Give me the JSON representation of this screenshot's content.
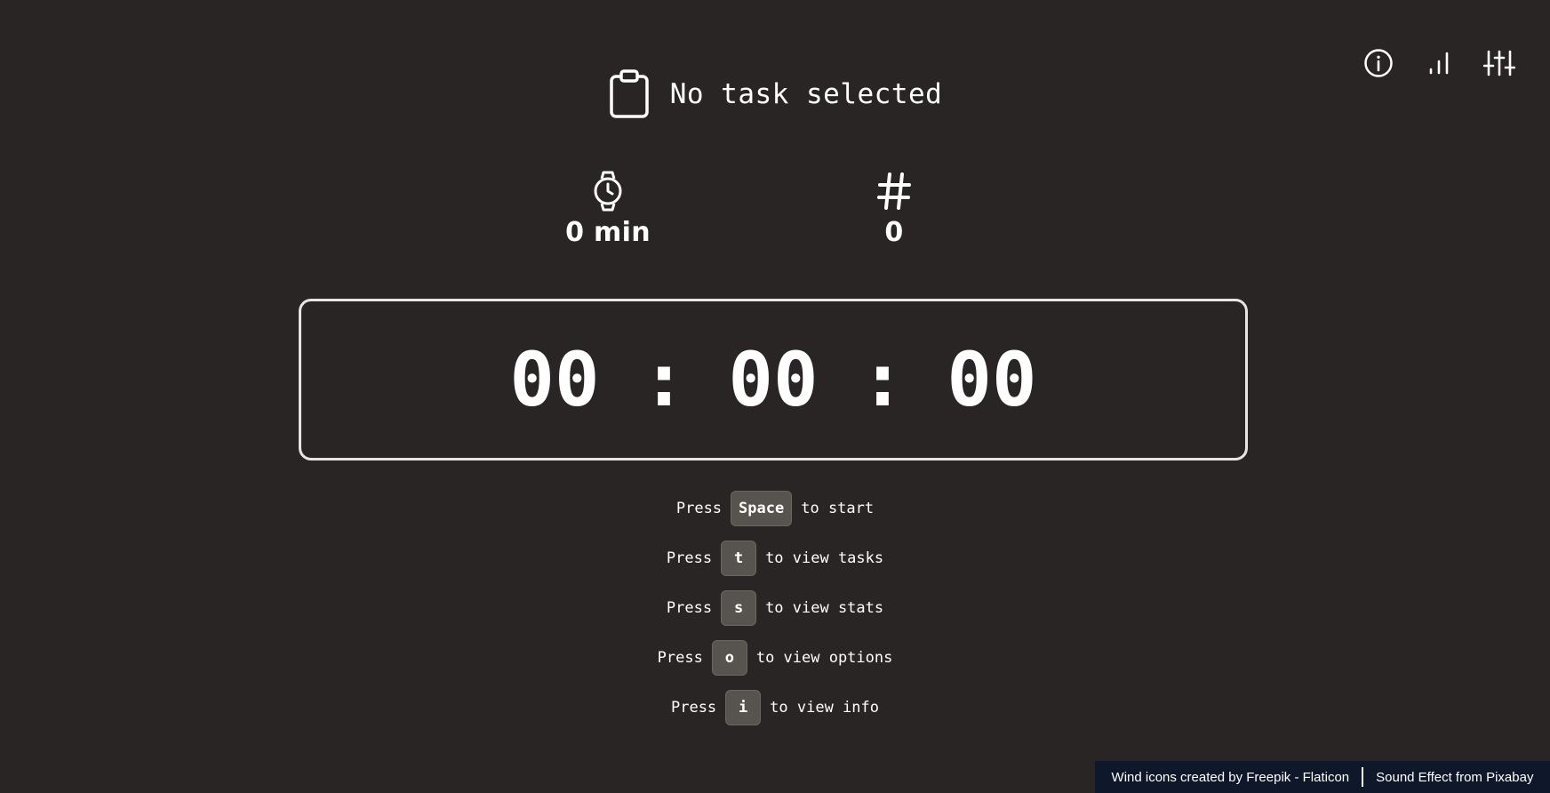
{
  "task": {
    "title": "No task selected",
    "icon": "clipboard-icon"
  },
  "toolbar": {
    "items": [
      {
        "name": "info",
        "icon": "info-icon"
      },
      {
        "name": "stats",
        "icon": "bar-chart-icon"
      },
      {
        "name": "options",
        "icon": "sliders-icon"
      }
    ]
  },
  "stats": {
    "duration": {
      "icon": "watch-icon",
      "value": "0 min"
    },
    "count": {
      "icon": "hash-icon",
      "value": "0"
    }
  },
  "timer": {
    "hours": "00",
    "minutes": "00",
    "seconds": "00",
    "separator": ":"
  },
  "shortcuts": [
    {
      "prefix": "Press",
      "key": "Space",
      "suffix": "to start"
    },
    {
      "prefix": "Press",
      "key": "t",
      "suffix": "to view tasks"
    },
    {
      "prefix": "Press",
      "key": "s",
      "suffix": "to view stats"
    },
    {
      "prefix": "Press",
      "key": "o",
      "suffix": "to view options"
    },
    {
      "prefix": "Press",
      "key": "i",
      "suffix": "to view info"
    }
  ],
  "footer": {
    "credit_icons": "Wind icons created by Freepik - Flaticon",
    "credit_sound": "Sound Effect from Pixabay"
  },
  "colors": {
    "background": "#292524",
    "key_background": "#57534e",
    "footer_background": "#0f172a",
    "foreground": "#ffffff"
  }
}
